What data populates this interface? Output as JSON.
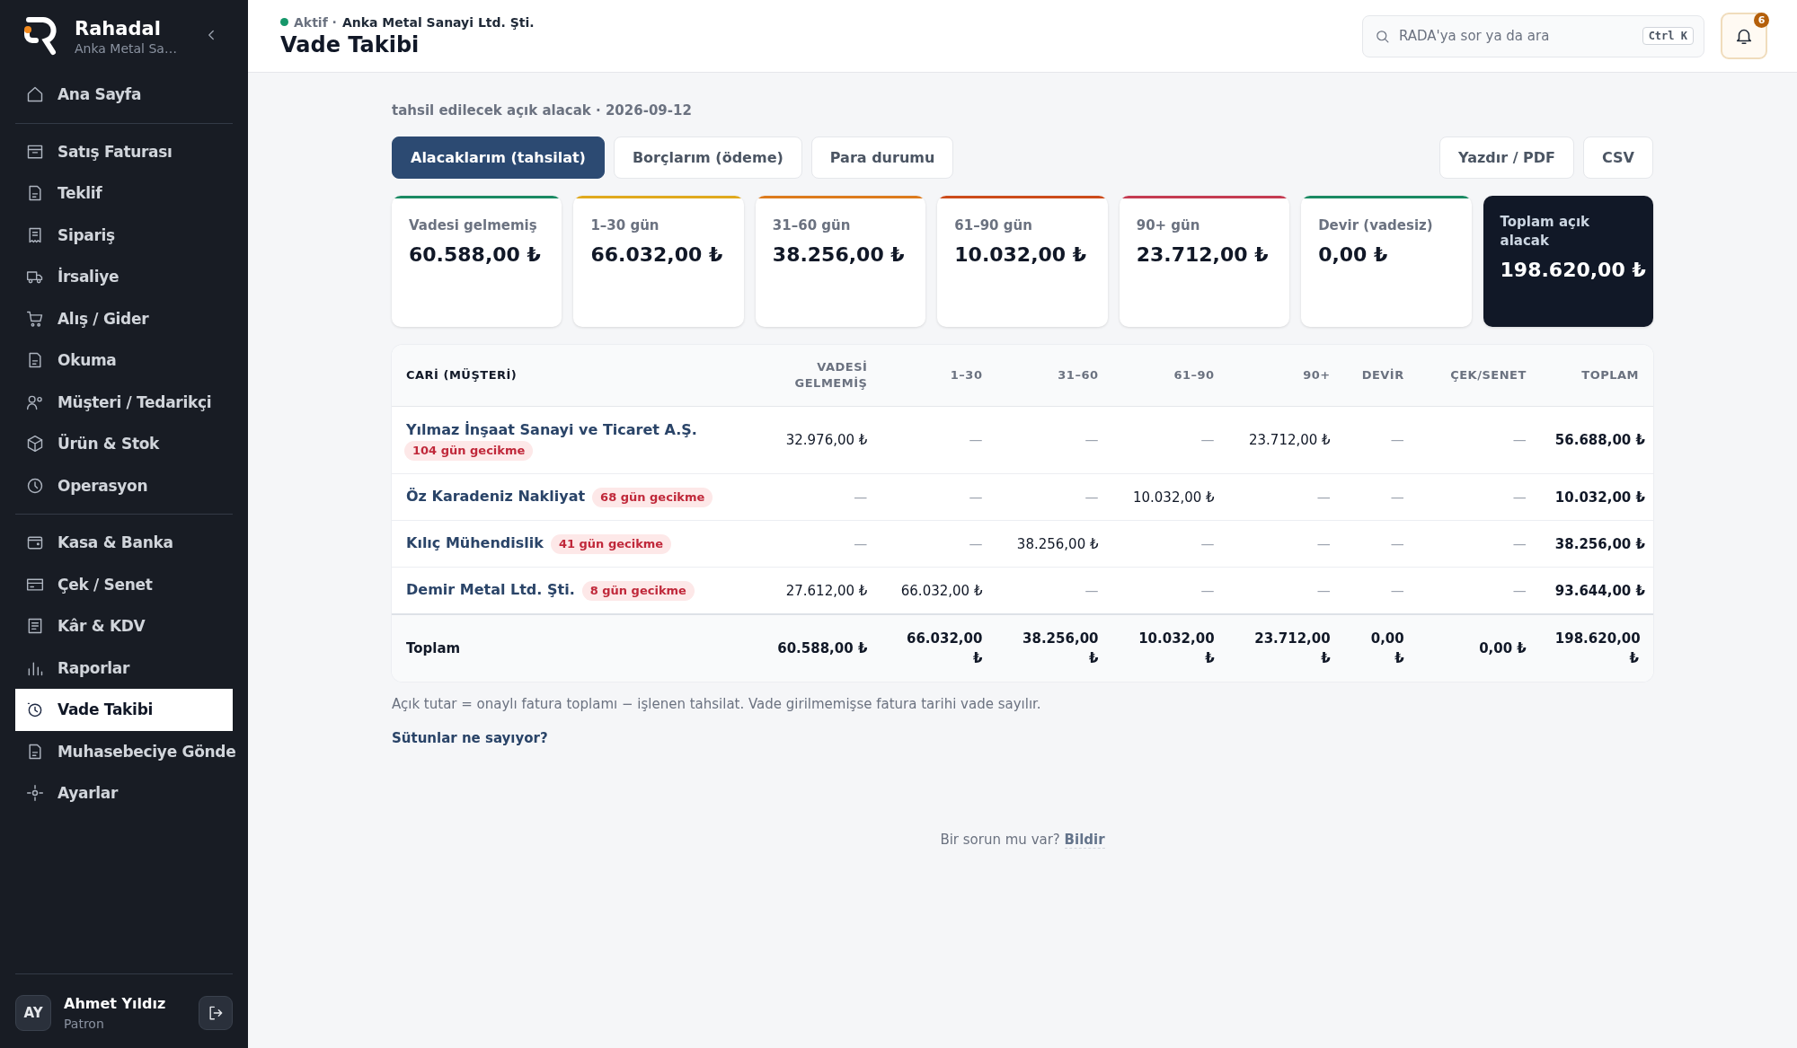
{
  "brand": {
    "name": "Rahadal",
    "company": "Anka Metal Sa…"
  },
  "sidebar": {
    "sections": [
      {
        "items": [
          {
            "label": "Ana Sayfa",
            "selected": false
          }
        ]
      },
      {
        "items": [
          {
            "label": "Satış Faturası",
            "selected": false
          },
          {
            "label": "Teklif",
            "selected": false
          },
          {
            "label": "Sipariş",
            "selected": false
          },
          {
            "label": "İrsaliye",
            "selected": false
          },
          {
            "label": "Alış / Gider",
            "selected": false
          },
          {
            "label": "Okuma",
            "selected": false
          },
          {
            "label": "Müşteri / Tedarikçi",
            "selected": false
          },
          {
            "label": "Ürün & Stok",
            "selected": false
          },
          {
            "label": "Operasyon",
            "selected": false
          }
        ]
      },
      {
        "items": [
          {
            "label": "Kasa & Banka",
            "selected": false
          },
          {
            "label": "Çek / Senet",
            "selected": false
          },
          {
            "label": "Kâr & KDV",
            "selected": false
          },
          {
            "label": "Raporlar",
            "selected": false
          },
          {
            "label": "Vade Takibi",
            "selected": true
          },
          {
            "label": "Muhasebeciye Gönde",
            "selected": false
          },
          {
            "label": "Ayarlar",
            "selected": false
          }
        ]
      }
    ]
  },
  "user": {
    "initials": "AY",
    "name": "Ahmet Yıldız",
    "role": "Patron"
  },
  "header": {
    "status": "Aktif ·",
    "company": "Anka Metal Sanayi Ltd. Şti.",
    "title": "Vade Takibi",
    "search": {
      "placeholder": "RADA'ya sor ya da ara",
      "shortcut": "Ctrl K"
    },
    "notifications": "6"
  },
  "subtitle": "tahsil edilecek açık alacak · 2026-09-12",
  "tabs": [
    {
      "label": "Alacaklarım (tahsilat)",
      "selected": true
    },
    {
      "label": "Borçlarım (ödeme)",
      "selected": false
    },
    {
      "label": "Para durumu",
      "selected": false
    }
  ],
  "actions": [
    "Yazdır / PDF",
    "CSV"
  ],
  "cards": [
    {
      "kind": "bucket",
      "label": "Vadesi gelmemiş",
      "value": "60.588,00 ₺",
      "color": "#1a8a63"
    },
    {
      "kind": "bucket",
      "label": "1–30 gün",
      "value": "66.032,00 ₺",
      "color": "#e0a91e"
    },
    {
      "kind": "bucket",
      "label": "31–60 gün",
      "value": "38.256,00 ₺",
      "color": "#dd7b1d"
    },
    {
      "kind": "bucket",
      "label": "61–90 gün",
      "value": "10.032,00 ₺",
      "color": "#cc4b1b"
    },
    {
      "kind": "bucket",
      "label": "90+ gün",
      "value": "23.712,00 ₺",
      "color": "#c53b52"
    },
    {
      "kind": "bucket",
      "label": "Devir (vadesiz)",
      "value": "0,00 ₺",
      "color": "#1a8a63"
    },
    {
      "kind": "total",
      "label": "Toplam açık alacak",
      "value": "198.620,00 ₺"
    }
  ],
  "table": {
    "columns": [
      "CARİ (MÜŞTERİ)",
      "VADESİ GELMEMİŞ",
      "1–30",
      "31–60",
      "61–90",
      "90+",
      "DEVİR",
      "ÇEK/SENET",
      "TOPLAM"
    ],
    "rows": [
      {
        "overdue": "104 gün gecikme",
        "cells": [
          "Yılmaz İnşaat Sanayi ve Ticaret A.Ş.",
          "32.976,00 ₺",
          "—",
          "—",
          "—",
          "23.712,00 ₺",
          "—",
          "—",
          "56.688,00 ₺"
        ]
      },
      {
        "overdue": "68 gün gecikme",
        "cells": [
          "Öz Karadeniz Nakliyat",
          "—",
          "—",
          "—",
          "10.032,00 ₺",
          "—",
          "—",
          "—",
          "10.032,00 ₺"
        ]
      },
      {
        "overdue": "41 gün gecikme",
        "cells": [
          "Kılıç Mühendislik",
          "—",
          "—",
          "38.256,00 ₺",
          "—",
          "—",
          "—",
          "—",
          "38.256,00 ₺"
        ]
      },
      {
        "overdue": "8 gün gecikme",
        "cells": [
          "Demir Metal Ltd. Şti.",
          "27.612,00 ₺",
          "66.032,00 ₺",
          "—",
          "—",
          "—",
          "—",
          "—",
          "93.644,00 ₺"
        ]
      }
    ],
    "total": {
      "cells": [
        "Toplam",
        "60.588,00 ₺",
        "66.032,00 ₺",
        "38.256,00 ₺",
        "10.032,00 ₺",
        "23.712,00 ₺",
        "0,00 ₺",
        "0,00 ₺",
        "198.620,00 ₺"
      ]
    }
  },
  "note": "Açık tutar = onaylı fatura toplamı − işlenen tahsilat. Vade girilmemişse fatura tarihi vade sayılır.",
  "help_link": "Sütunlar ne sayıyor?",
  "feedback": {
    "text": "Bir sorun mu var?",
    "link": "Bildir"
  }
}
